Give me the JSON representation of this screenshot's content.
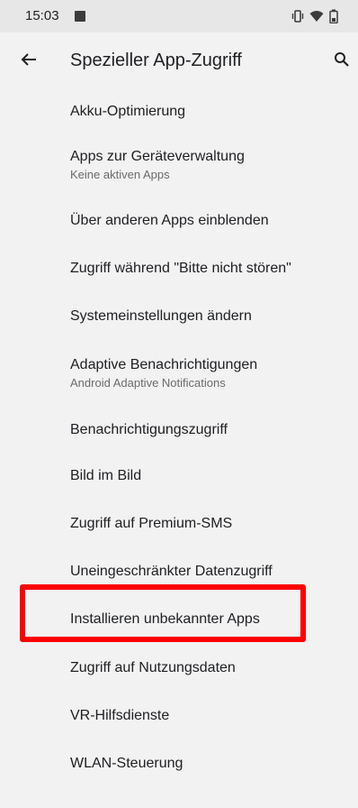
{
  "status_bar": {
    "time": "15:03",
    "icons": [
      "notification-icon",
      "vibrate-icon",
      "wifi-icon",
      "battery-icon"
    ]
  },
  "app_bar": {
    "title": "Spezieller App-Zugriff",
    "back_icon": "arrow-back-icon",
    "search_icon": "search-icon"
  },
  "items": [
    {
      "title": "Akku-Optimierung",
      "subtitle": ""
    },
    {
      "title": "Apps zur Geräteverwaltung",
      "subtitle": "Keine aktiven Apps"
    },
    {
      "title": "Über anderen Apps einblenden",
      "subtitle": ""
    },
    {
      "title": "Zugriff während \"Bitte nicht stören\"",
      "subtitle": ""
    },
    {
      "title": "Systemeinstellungen ändern",
      "subtitle": ""
    },
    {
      "title": "Adaptive Benachrichtigungen",
      "subtitle": "Android Adaptive Notifications"
    },
    {
      "title": "Benachrichtigungszugriff",
      "subtitle": ""
    },
    {
      "title": "Bild im Bild",
      "subtitle": ""
    },
    {
      "title": "Zugriff auf Premium-SMS",
      "subtitle": ""
    },
    {
      "title": "Uneingeschränkter Datenzugriff",
      "subtitle": ""
    },
    {
      "title": "Installieren unbekannter Apps",
      "subtitle": ""
    },
    {
      "title": "Zugriff auf Nutzungsdaten",
      "subtitle": ""
    },
    {
      "title": "VR-Hilfsdienste",
      "subtitle": ""
    },
    {
      "title": "WLAN-Steuerung",
      "subtitle": ""
    }
  ],
  "colors": {
    "background": "#f2f2f2",
    "status_bar": "#e7e7e7",
    "highlight": "#ff0000"
  }
}
